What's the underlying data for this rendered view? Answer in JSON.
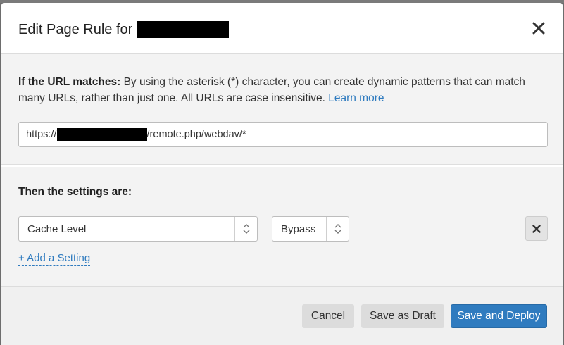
{
  "modal": {
    "title": "Edit Page Rule for",
    "close_icon": "close-icon"
  },
  "url_section": {
    "label": "If the URL matches:",
    "description": " By using the asterisk (*) character, you can create dynamic patterns that can match many URLs, rather than just one. All URLs are case insensitive. ",
    "learn_more": "Learn more",
    "url_prefix": "https://",
    "url_suffix": "/remote.php/webdav/*"
  },
  "settings_section": {
    "heading": "Then the settings are:",
    "setting_name": "Cache Level",
    "setting_value": "Bypass",
    "add_setting": "+ Add a Setting"
  },
  "footer": {
    "cancel": "Cancel",
    "save_draft": "Save as Draft",
    "save_deploy": "Save and Deploy"
  },
  "colors": {
    "accent": "#2f7bbf",
    "panel": "#f3f3f3"
  }
}
